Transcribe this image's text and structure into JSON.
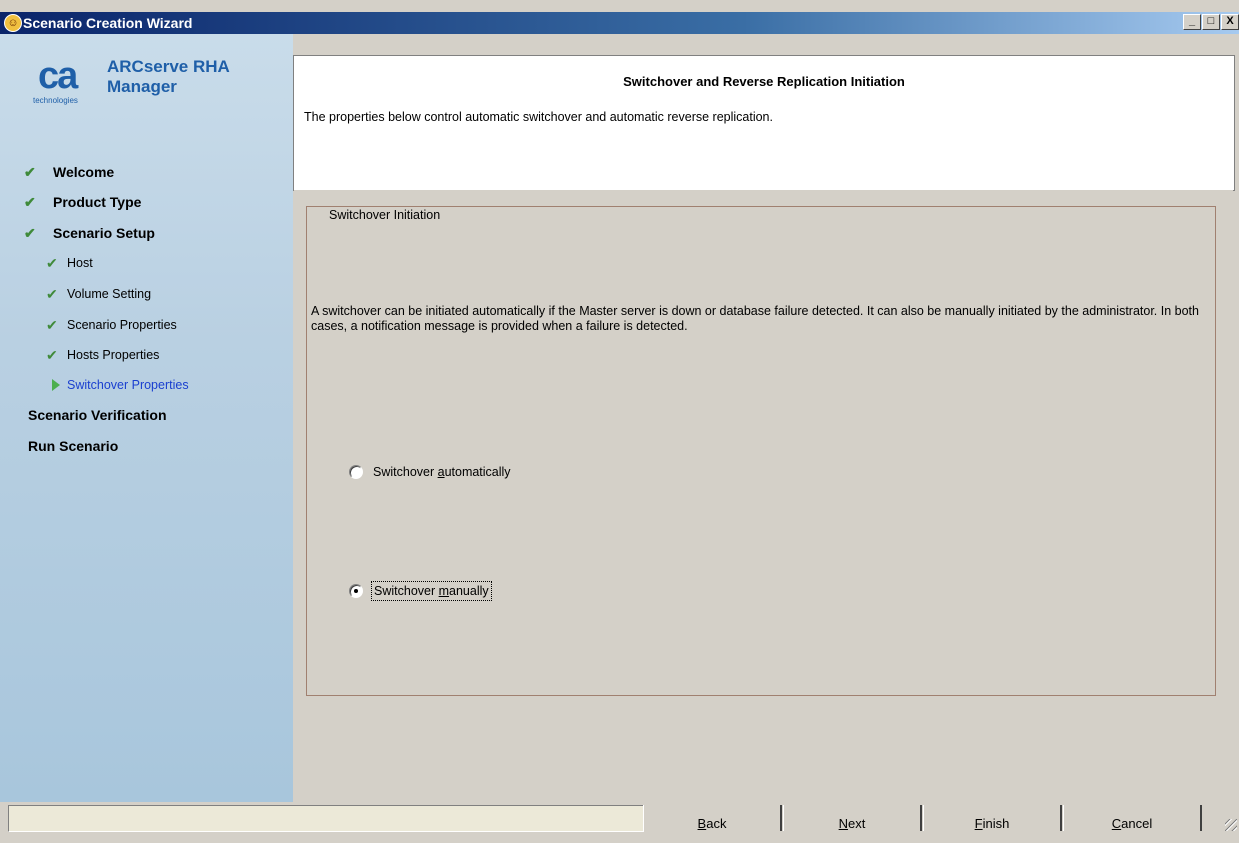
{
  "window": {
    "title": "Scenario Creation Wizard",
    "icon": "wizard-icon",
    "buttons": {
      "minimize": "_",
      "maximize": "□",
      "close": "X"
    }
  },
  "logo": {
    "brand": "ca",
    "tagline": "technologies",
    "product_line1": "ARCserve RHA",
    "product_line2": "Manager"
  },
  "sidebar": {
    "items": [
      {
        "label": "Welcome",
        "state": "done",
        "level": "top"
      },
      {
        "label": "Product Type",
        "state": "done",
        "level": "top"
      },
      {
        "label": "Scenario Setup",
        "state": "done",
        "level": "top"
      },
      {
        "label": "Host",
        "state": "done",
        "level": "sub"
      },
      {
        "label": "Volume Setting",
        "state": "done",
        "level": "sub"
      },
      {
        "label": "Scenario Properties",
        "state": "done",
        "level": "sub"
      },
      {
        "label": "Hosts Properties",
        "state": "done",
        "level": "sub"
      },
      {
        "label": "Switchover Properties",
        "state": "current",
        "level": "sub"
      },
      {
        "label": "Scenario Verification",
        "state": "pending",
        "level": "top"
      },
      {
        "label": "Run Scenario",
        "state": "pending",
        "level": "top"
      }
    ]
  },
  "header": {
    "title": "Switchover and Reverse Replication Initiation",
    "description": "The properties below control automatic switchover and automatic reverse replication."
  },
  "group": {
    "title": "Switchover Initiation",
    "description": "A switchover can be initiated automatically if the Master server is down or database failure detected. It can also be manually initiated by the administrator. In both cases, a notification message is provided when a failure is detected.",
    "options": [
      {
        "pre": "Switchover ",
        "mnemonic": "a",
        "post": "utomatically",
        "selected": false
      },
      {
        "pre": "Switchover ",
        "mnemonic": "m",
        "post": "anually",
        "selected": true
      }
    ]
  },
  "buttons": {
    "back": {
      "mnemonic": "B",
      "rest": "ack"
    },
    "next": {
      "mnemonic": "N",
      "rest": "ext"
    },
    "finish": {
      "mnemonic": "F",
      "rest": "inish"
    },
    "cancel": {
      "mnemonic": "C",
      "rest": "ancel"
    }
  },
  "colors": {
    "accent": "#1f5fa8",
    "current_step": "#1a3fd0",
    "check": "#3f8a3a"
  }
}
